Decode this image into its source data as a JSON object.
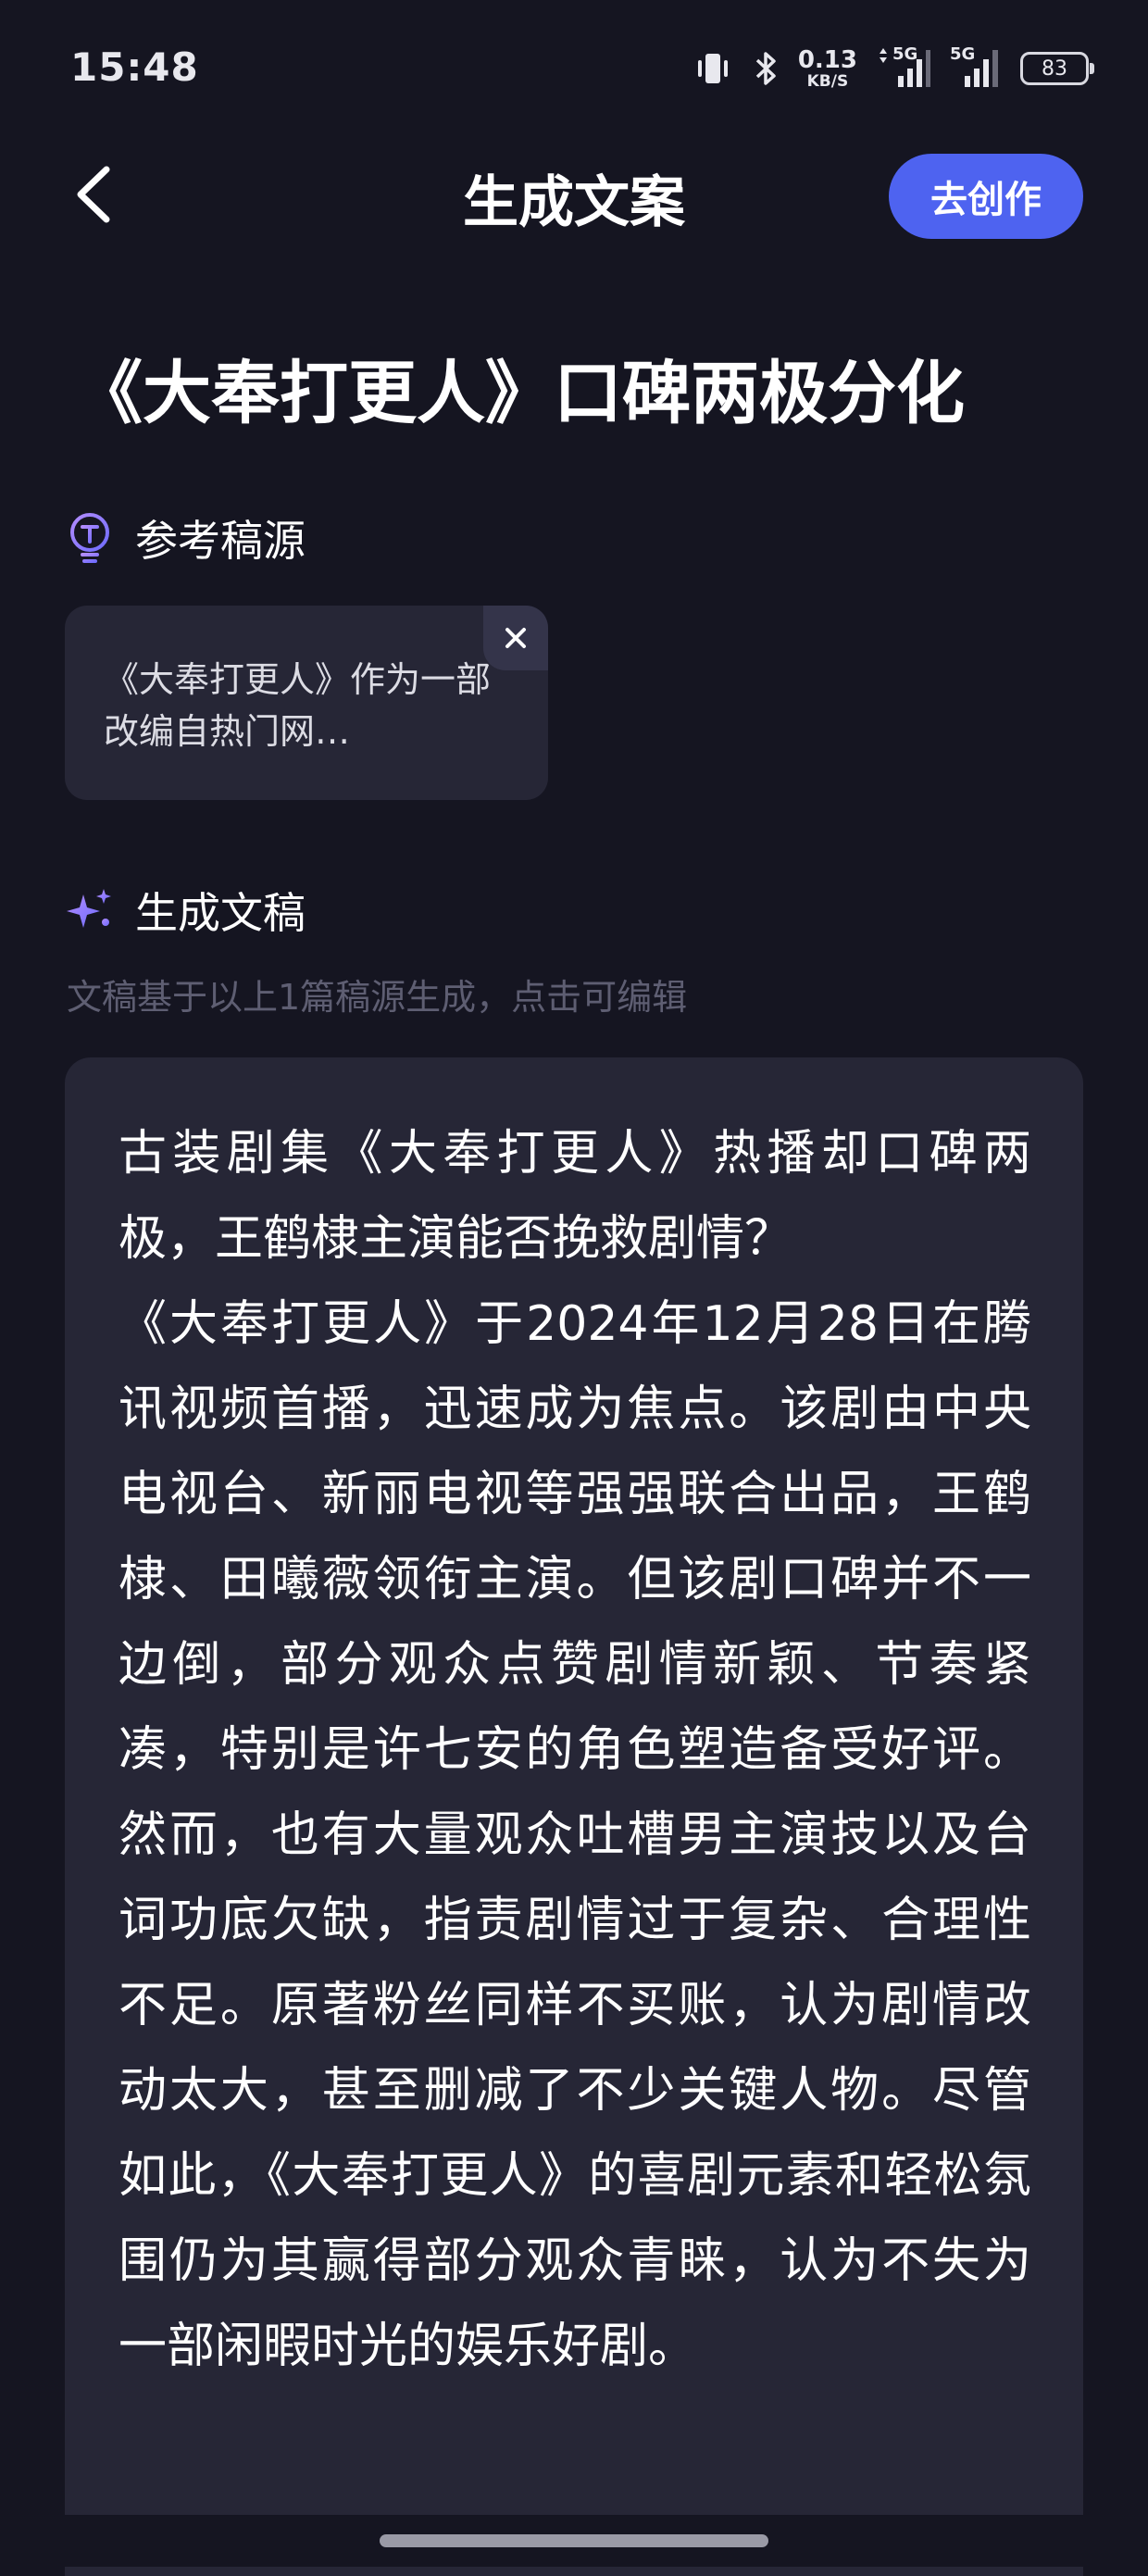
{
  "status_bar": {
    "time": "15:48",
    "net_speed_value": "0.13",
    "net_speed_unit": "KB/S",
    "signal_1_label": "5G",
    "signal_2_label": "5G",
    "battery": "83"
  },
  "header": {
    "title": "生成文案",
    "create_button_label": "去创作"
  },
  "article": {
    "title": "《大奉打更人》口碑两极分化"
  },
  "reference_section": {
    "label": "参考稿源",
    "card_text": "《大奉打更人》作为一部改编自热门网…"
  },
  "generated_section": {
    "label": "生成文稿",
    "hint": "文稿基于以上1篇稿源生成，点击可编辑",
    "content": "古装剧集《大奉打更人》热播却口碑两极，王鹤棣主演能否挽救剧情？\n《大奉打更人》于2024年12月28日在腾讯视频首播，迅速成为焦点。该剧由中央电视台、新丽电视等强强联合出品，王鹤棣、田曦薇领衔主演。但该剧口碑并不一边倒，部分观众点赞剧情新颖、节奏紧凑，特别是许七安的角色塑造备受好评。然而，也有大量观众吐槽男主演技以及台词功底欠缺，指责剧情过于复杂、合理性不足。原著粉丝同样不买账，认为剧情改动太大，甚至删减了不少关键人物。尽管如此，《大奉打更人》的喜剧元素和轻松氛围仍为其赢得部分观众青睐，认为不失为一部闲暇时光的娱乐好剧。"
  },
  "colors": {
    "background": "#151521",
    "card": "#262636",
    "accent": "#4e63f0",
    "hint": "#5e5e72"
  }
}
